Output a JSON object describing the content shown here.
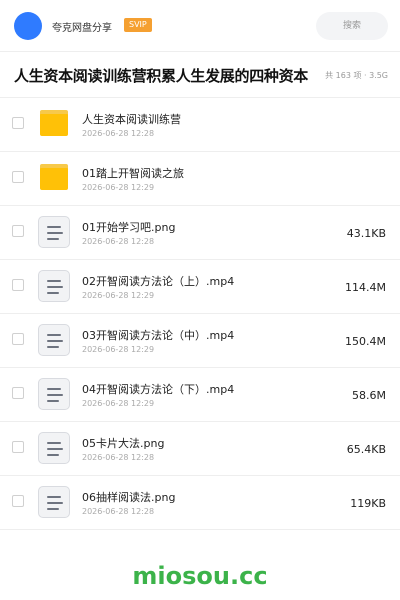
{
  "header": {
    "brand": "夸克网盘分享",
    "badge": "SVIP",
    "search_placeholder": "搜索"
  },
  "title_bar": {
    "title": "人生资本阅读训练营积累人生发展的四种资本",
    "summary": "共 163 项 · 3.5G"
  },
  "files": [
    {
      "name": "人生资本阅读训练营",
      "date": "2026-06-28 12:28",
      "size": "",
      "icon": "folder-icon"
    },
    {
      "name": "01踏上开智阅读之旅",
      "date": "2026-06-28 12:29",
      "size": "",
      "icon": "folder-icon"
    },
    {
      "name": "01开始学习吧.png",
      "date": "2026-06-28 12:28",
      "size": "43.1KB",
      "icon": "file-icon"
    },
    {
      "name": "02开智阅读方法论（上）.mp4",
      "date": "2026-06-28 12:29",
      "size": "114.4M",
      "icon": "file-icon"
    },
    {
      "name": "03开智阅读方法论（中）.mp4",
      "date": "2026-06-28 12:29",
      "size": "150.4M",
      "icon": "file-icon"
    },
    {
      "name": "04开智阅读方法论（下）.mp4",
      "date": "2026-06-28 12:29",
      "size": "58.6M",
      "icon": "file-icon"
    },
    {
      "name": "05卡片大法.png",
      "date": "2026-06-28 12:28",
      "size": "65.4KB",
      "icon": "file-icon"
    },
    {
      "name": "06抽样阅读法.png",
      "date": "2026-06-28 12:28",
      "size": "119KB",
      "icon": "file-icon"
    }
  ],
  "watermark": "miosou.cc",
  "colors": {
    "accent": "#2f7bff",
    "svip": "#f5a031",
    "folder": "#ffc107",
    "watermark": "#3cb34a"
  }
}
